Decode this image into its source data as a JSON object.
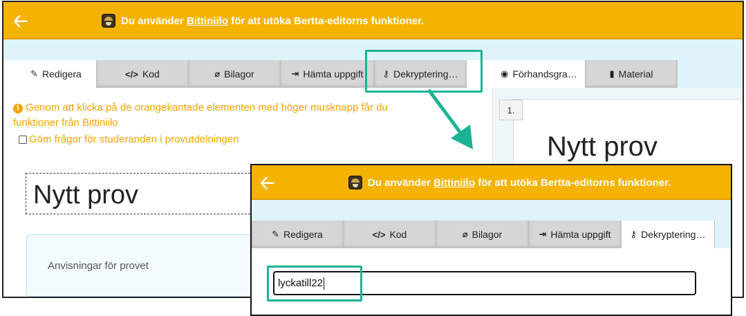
{
  "banner": {
    "text_before": "Du använder ",
    "link": "Bittiniilo",
    "text_after": " för att utöka Bertta-editorns funktioner.",
    "color": "#f5b301"
  },
  "icons": {
    "back": "arrow-left-icon",
    "spy": "spy-avatar-icon"
  },
  "editor_tabs": [
    {
      "label": "Redigera",
      "icon": "✎"
    },
    {
      "label": "Kod",
      "icon": "</>"
    },
    {
      "label": "Bilagor",
      "icon": "⌀"
    },
    {
      "label": "Hämta uppgift",
      "icon": "⇥"
    },
    {
      "label": "Dekryptering…",
      "icon": "⚷"
    }
  ],
  "preview_tabs": [
    {
      "label": "Förhandsgra…",
      "icon": "◉"
    },
    {
      "label": "Material",
      "icon": "▮"
    }
  ],
  "info": {
    "icon": "i",
    "text_line1": "Genom att klicka på de orangekantade elementen med höger musknapp får du",
    "text_line2": "funktioner från Bittiniilo",
    "checkbox_label": "Göm frågor för studeranden i provutdelningen",
    "color": "#f5a300"
  },
  "exam": {
    "title": "Nytt prov",
    "instructions": "Anvisningar för provet"
  },
  "preview": {
    "question_number": "1.",
    "title": "Nytt prov"
  },
  "decrypt": {
    "value": "lyckatill22"
  },
  "colors": {
    "highlight": "#1ab394",
    "accent_band": "#dff3fb"
  }
}
